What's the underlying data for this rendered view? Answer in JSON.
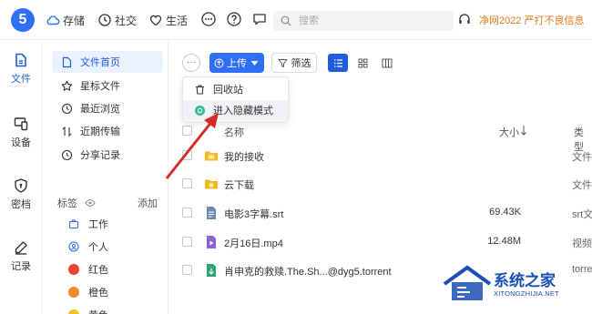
{
  "topbar": {
    "logo": "5",
    "nav": [
      {
        "label": "存储",
        "icon": "cloud-icon"
      },
      {
        "label": "社交",
        "icon": "clock-icon"
      },
      {
        "label": "生活",
        "icon": "heart-icon"
      }
    ],
    "more_icon": "ellipsis-circle-icon",
    "help_icon": "question-circle-icon",
    "message_icon": "chat-bubble-icon",
    "search_placeholder": "搜索",
    "headset_icon": "headset-icon",
    "promo_text": "净网2022 严打不良信息"
  },
  "rail": {
    "items": [
      {
        "label": "文件",
        "icon": "file-icon",
        "active": true
      },
      {
        "label": "设备",
        "icon": "devices-icon"
      },
      {
        "label": "密档",
        "icon": "shield-lock-icon"
      },
      {
        "label": "记录",
        "icon": "pen-icon"
      }
    ]
  },
  "sidebar": {
    "items": [
      {
        "label": "文件首页",
        "icon": "document-icon",
        "active": true
      },
      {
        "label": "星标文件",
        "icon": "star-icon"
      },
      {
        "label": "最近浏览",
        "icon": "clock-icon"
      },
      {
        "label": "近期传输",
        "icon": "transfer-icon"
      },
      {
        "label": "分享记录",
        "icon": "share-icon"
      }
    ],
    "tags_title": "标签",
    "tags_add": "添加",
    "tags": [
      {
        "label": "工作",
        "icon": "briefcase-icon"
      },
      {
        "label": "个人",
        "icon": "person-icon"
      },
      {
        "label": "红色",
        "color": "#e8462f"
      },
      {
        "label": "橙色",
        "color": "#f08a24"
      },
      {
        "label": "黄色",
        "color": "#f2c21d"
      }
    ]
  },
  "toolbar": {
    "more_label": "···",
    "upload_label": "上传",
    "filter_label": "筛选",
    "views": [
      "list-view-icon",
      "grid-view-icon",
      "column-view-icon"
    ]
  },
  "menu": {
    "items": [
      {
        "label": "回收站",
        "icon": "trash-icon"
      },
      {
        "label": "进入隐藏模式",
        "icon": "hidden-mode-icon"
      }
    ]
  },
  "list": {
    "headers": {
      "name": "名称",
      "size": "大小",
      "type": "类型"
    },
    "rows": [
      {
        "name": "我的接收",
        "size": "",
        "type": "文件",
        "icon": "folder-icon"
      },
      {
        "name": "云下载",
        "size": "",
        "type": "文件",
        "icon": "cloud-folder-icon"
      },
      {
        "name": "电影3字幕.srt",
        "size": "69.43K",
        "type": "srt文",
        "icon": "text-file-icon"
      },
      {
        "name": "2月16日.mp4",
        "size": "12.48M",
        "type": "视频",
        "icon": "video-file-icon"
      },
      {
        "name": "肖申克的救赎.The.Sh...@dyg5.torrent",
        "size": "",
        "type": "torrent",
        "icon": "torrent-file-icon"
      }
    ]
  },
  "watermark": {
    "title": "系统之家",
    "url": "XITONGZHIJIA.NET"
  },
  "colors": {
    "accent": "#2f6ff5",
    "promo": "#e07a1f",
    "annotation": "#d42a2a"
  }
}
